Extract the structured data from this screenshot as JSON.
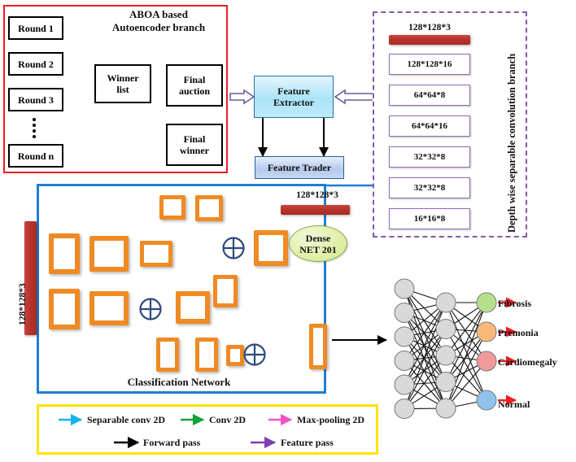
{
  "aboa": {
    "title_line1": "ABOA based",
    "title_line2": "Autoencoder branch",
    "rounds": [
      "Round 1",
      "Round 2",
      "Round 3",
      "Round n"
    ],
    "winner_list": "Winner\nlist",
    "winner_list_l1": "Winner",
    "winner_list_l2": "list",
    "final_auction_l1": "Final",
    "final_auction_l2": "auction",
    "final_winner_l1": "Final",
    "final_winner_l2": "winner",
    "border_color": "#ee1c25"
  },
  "middle": {
    "feature_extractor_l1": "Feature",
    "feature_extractor_l2": "Extractor",
    "feature_trader": "Feature Trader"
  },
  "dwsc": {
    "title": "Depth wise separable convolution branch",
    "input_label": "128*128*3",
    "layers": [
      "128*128*16",
      "64*64*8",
      "64*64*16",
      "32*32*8",
      "32*32*8",
      "16*16*8"
    ],
    "border_color": "#7b5ea7"
  },
  "classification": {
    "title": "Classification Network",
    "input_label": "128*128*3",
    "feature_input_label": "128*128*3",
    "dense_l1": "Dense",
    "dense_l2": "NET 201",
    "border_color": "#1f7fd0"
  },
  "legend": {
    "border_color": "#ffe400",
    "items": [
      {
        "label": "Separable conv 2D",
        "color": "#12b4ea"
      },
      {
        "label": "Conv 2D",
        "color": "#13a438"
      },
      {
        "label": "Max-pooling 2D",
        "color": "#f252c8"
      },
      {
        "label": "Forward pass",
        "color": "#000000"
      },
      {
        "label": "Feature pass",
        "color": "#7b3fb5"
      }
    ]
  },
  "outputs": [
    {
      "label": "Fibrosis",
      "color": "#b5e08a"
    },
    {
      "label": "Premonia",
      "color": "#f8b97a"
    },
    {
      "label": "Cardiomegaly",
      "color": "#f29a9a"
    },
    {
      "label": "Normal",
      "color": "#8fc2ef"
    }
  ],
  "network": {
    "input_nodes": 6,
    "hidden_nodes": 5,
    "output_nodes": 4,
    "node_color": "#d9d9d9",
    "arrow_color": "#ee1c25"
  }
}
